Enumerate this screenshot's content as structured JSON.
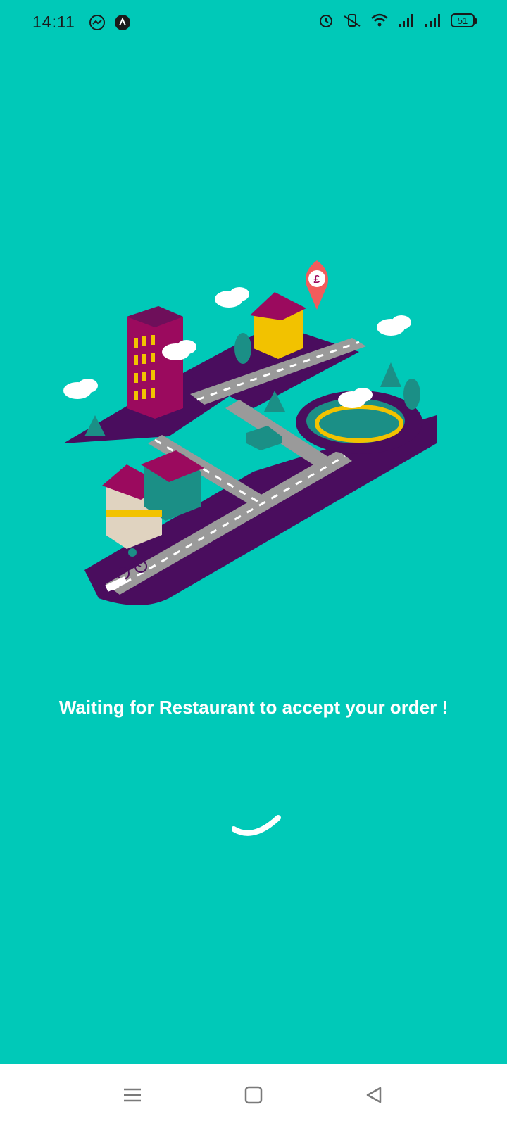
{
  "status_bar": {
    "time": "14:11",
    "battery": "51",
    "left_icons": [
      "messenger-icon",
      "app-a-icon"
    ],
    "right_icons": [
      "alarm-icon",
      "vibrate-mute-icon",
      "wifi-icon",
      "signal-icon",
      "signal-icon",
      "battery-icon"
    ]
  },
  "main": {
    "message": "Waiting for Restaurant to accept your order !",
    "illustration_price_pin": "£"
  },
  "colors": {
    "background": "#00C9B8",
    "text": "#FFFFFF",
    "road_base": "#4A0D5E"
  },
  "nav_bar": {
    "icons": [
      "menu-icon",
      "home-square-icon",
      "back-triangle-icon"
    ]
  }
}
